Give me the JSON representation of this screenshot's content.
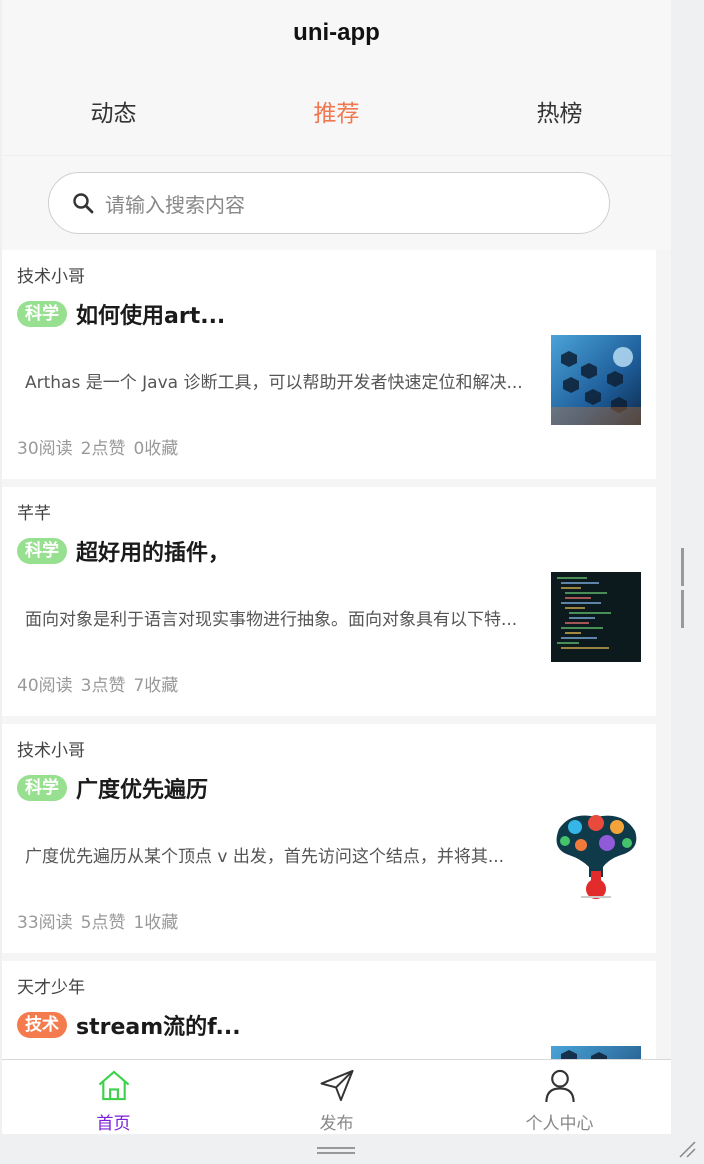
{
  "navbar": {
    "title": "uni-app"
  },
  "tabs": [
    {
      "label": "动态",
      "active": false
    },
    {
      "label": "推荐",
      "active": true
    },
    {
      "label": "热榜",
      "active": false
    }
  ],
  "search": {
    "placeholder": "请输入搜索内容"
  },
  "articles": [
    {
      "author": "技术小哥",
      "tag": "科学",
      "tag_color": "#97e08f",
      "title": "如何使用art...",
      "summary": "Arthas 是一个 Java 诊断工具，可以帮助开发者快速定位和解决...",
      "stats": {
        "reads": "30阅读",
        "likes": "2点赞",
        "favs": "0收藏"
      },
      "thumb": "tech-hexagon-image"
    },
    {
      "author": "芊芊",
      "tag": "科学",
      "tag_color": "#97e08f",
      "title": "超好用的插件，",
      "summary": "面向对象是利于语言对现实事物进行抽象。面向对象具有以下特...",
      "stats": {
        "reads": "40阅读",
        "likes": "3点赞",
        "favs": "7收藏"
      },
      "thumb": "code-screen-image"
    },
    {
      "author": "技术小哥",
      "tag": "科学",
      "tag_color": "#97e08f",
      "title": "广度优先遍历",
      "summary": "广度优先遍历从某个顶点 v 出发，首先访问这个结点，并将其...",
      "stats": {
        "reads": "33阅读",
        "likes": "5点赞",
        "favs": "1收藏"
      },
      "thumb": "science-flask-image"
    },
    {
      "author": "天才少年",
      "tag": "技术",
      "tag_color": "#f47b4d",
      "title": "stream流的f...",
      "summary": "",
      "stats": {
        "reads": "",
        "likes": "",
        "favs": ""
      },
      "thumb": "tech-hexagon-image"
    }
  ],
  "tabbar": [
    {
      "label": "首页",
      "icon": "home-icon",
      "active": true
    },
    {
      "label": "发布",
      "icon": "send-icon",
      "active": false
    },
    {
      "label": "个人中心",
      "icon": "user-icon",
      "active": false
    }
  ],
  "colors": {
    "accent": "#f07850",
    "tab_active": "#7a1fd8",
    "tag_green": "#97e08f",
    "tag_orange": "#f47b4d"
  }
}
